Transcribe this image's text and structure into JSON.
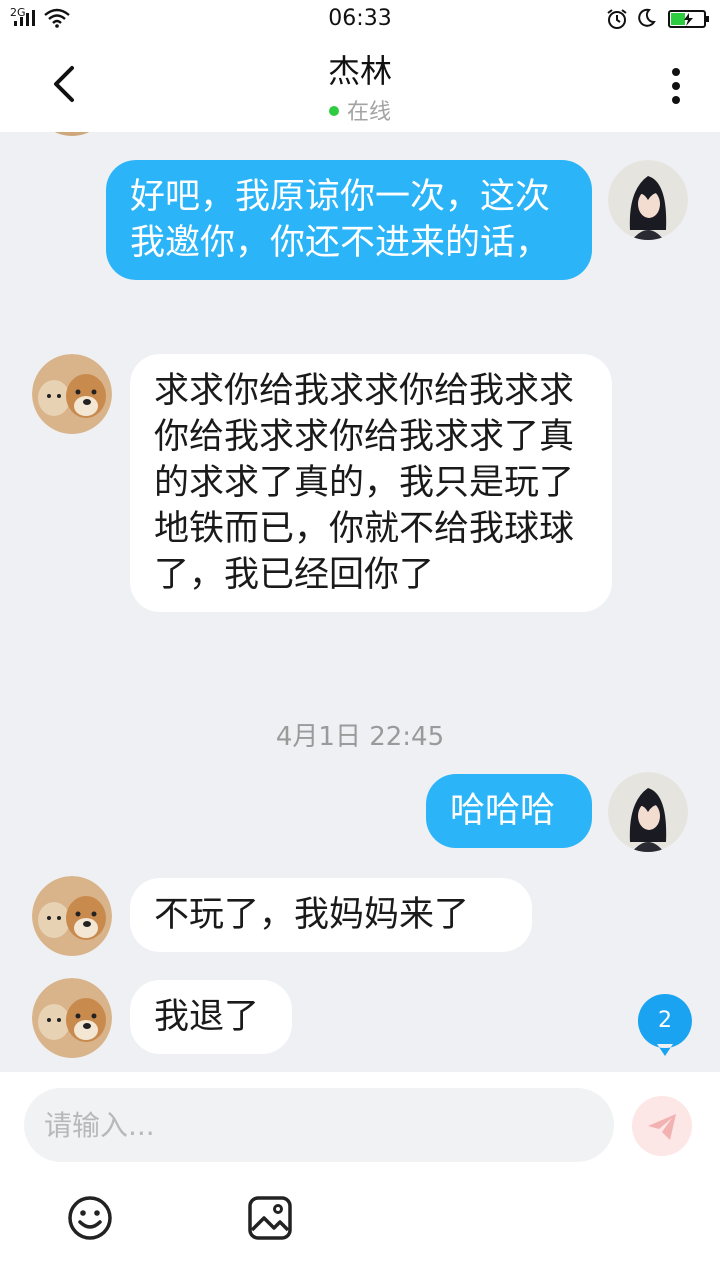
{
  "status_bar": {
    "network": "2G",
    "time": "06:33",
    "icons": [
      "signal-icon",
      "wifi-icon",
      "alarm-icon",
      "moon-icon",
      "battery-charging-icon"
    ]
  },
  "header": {
    "title": "杰林",
    "presence": "在线",
    "presence_color": "#2ecc40",
    "icons": [
      "back-icon",
      "more-icon"
    ]
  },
  "messages": [
    {
      "side": "out",
      "text": "好吧，我原谅你一次，这次我邀你，你还不进来的话，",
      "avatar": "anime-avatar"
    },
    {
      "side": "in",
      "text": "求求你给我求求你给我求求你给我求求你给我求求了真的求求了真的，我只是玩了地铁而已，你就不给我球球了，我已经回你了",
      "avatar": "shiba-dogs-avatar"
    },
    {
      "side": "out",
      "text": "哈哈哈",
      "avatar": "anime-avatar"
    },
    {
      "side": "in",
      "text": "不玩了，我妈妈来了",
      "avatar": "shiba-dogs-avatar"
    },
    {
      "side": "in",
      "text": "我退了",
      "avatar": "shiba-dogs-avatar"
    }
  ],
  "timestamp": "4月1日 22:45",
  "unread_badge": "2",
  "input": {
    "placeholder": "请输入..."
  },
  "toolbar": {
    "icons": [
      "send-icon",
      "emoji-icon",
      "image-icon"
    ]
  },
  "colors": {
    "outgoing_bubble": "#2bb4f8",
    "incoming_bubble": "#ffffff",
    "chat_background": "#eef0f4",
    "badge": "#1aa3f0"
  }
}
